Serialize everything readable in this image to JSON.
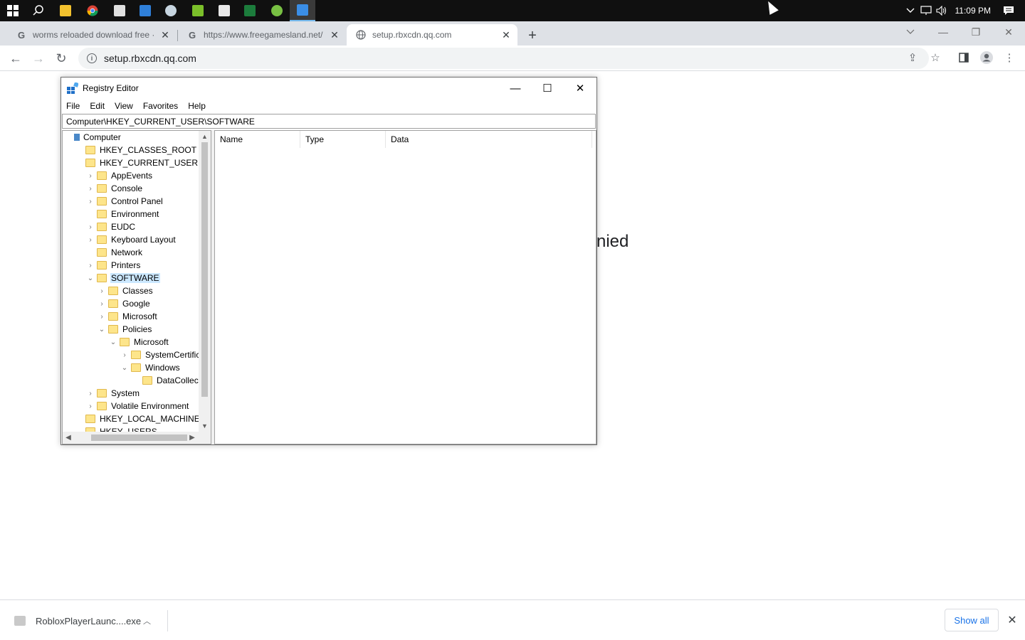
{
  "taskbar": {
    "icons": [
      {
        "name": "windows-start",
        "color": "#ffffff"
      },
      {
        "name": "search",
        "color": "#ffffff"
      },
      {
        "name": "file-explorer",
        "color": "#f2c12e"
      },
      {
        "name": "chrome",
        "color": "#4285f4"
      },
      {
        "name": "notes",
        "color": "#e0e0e0"
      },
      {
        "name": "app-blue",
        "color": "#2f7fd8"
      },
      {
        "name": "steam",
        "color": "#c7d5e0"
      },
      {
        "name": "bluestacks",
        "color": "#7bbf2a"
      },
      {
        "name": "7zip",
        "color": "#e8e8e8"
      },
      {
        "name": "app-green",
        "color": "#1c7c3c"
      },
      {
        "name": "utorrent",
        "color": "#78c043"
      },
      {
        "name": "regedit",
        "color": "#3a8ee6"
      }
    ],
    "clock": "11:09 PM"
  },
  "browser": {
    "tabs": [
      {
        "title": "worms reloaded download free ·",
        "favicon": "G",
        "active": false
      },
      {
        "title": "https://www.freegamesland.net/",
        "favicon": "G",
        "active": false
      },
      {
        "title": "setup.rbxcdn.qq.com",
        "favicon": "globe",
        "active": true
      }
    ],
    "address": "setup.rbxcdn.qq.com",
    "page_text_fragment": "nied"
  },
  "regedit": {
    "title": "Registry Editor",
    "menu": [
      "File",
      "Edit",
      "View",
      "Favorites",
      "Help"
    ],
    "address": "Computer\\HKEY_CURRENT_USER\\SOFTWARE",
    "tree": [
      {
        "label": "Computer",
        "depth": 0,
        "expander": "",
        "icon": "computer",
        "selected": false
      },
      {
        "label": "HKEY_CLASSES_ROOT",
        "depth": 1,
        "expander": "",
        "icon": "folder",
        "selected": false
      },
      {
        "label": "HKEY_CURRENT_USER",
        "depth": 1,
        "expander": "",
        "icon": "folder",
        "selected": false
      },
      {
        "label": "AppEvents",
        "depth": 2,
        "expander": ">",
        "icon": "folder",
        "selected": false
      },
      {
        "label": "Console",
        "depth": 2,
        "expander": ">",
        "icon": "folder",
        "selected": false
      },
      {
        "label": "Control Panel",
        "depth": 2,
        "expander": ">",
        "icon": "folder",
        "selected": false
      },
      {
        "label": "Environment",
        "depth": 2,
        "expander": "",
        "icon": "folder",
        "selected": false
      },
      {
        "label": "EUDC",
        "depth": 2,
        "expander": ">",
        "icon": "folder",
        "selected": false
      },
      {
        "label": "Keyboard Layout",
        "depth": 2,
        "expander": ">",
        "icon": "folder",
        "selected": false
      },
      {
        "label": "Network",
        "depth": 2,
        "expander": "",
        "icon": "folder",
        "selected": false
      },
      {
        "label": "Printers",
        "depth": 2,
        "expander": ">",
        "icon": "folder",
        "selected": false
      },
      {
        "label": "SOFTWARE",
        "depth": 2,
        "expander": "v",
        "icon": "folder",
        "selected": true
      },
      {
        "label": "Classes",
        "depth": 3,
        "expander": ">",
        "icon": "folder",
        "selected": false
      },
      {
        "label": "Google",
        "depth": 3,
        "expander": ">",
        "icon": "folder",
        "selected": false
      },
      {
        "label": "Microsoft",
        "depth": 3,
        "expander": ">",
        "icon": "folder",
        "selected": false
      },
      {
        "label": "Policies",
        "depth": 3,
        "expander": "v",
        "icon": "folder",
        "selected": false
      },
      {
        "label": "Microsoft",
        "depth": 4,
        "expander": "v",
        "icon": "folder",
        "selected": false
      },
      {
        "label": "SystemCertificates",
        "depth": 5,
        "expander": ">",
        "icon": "folder",
        "selected": false
      },
      {
        "label": "Windows",
        "depth": 5,
        "expander": "v",
        "icon": "folder",
        "selected": false
      },
      {
        "label": "DataCollection",
        "depth": 6,
        "expander": "",
        "icon": "folder",
        "selected": false
      },
      {
        "label": "System",
        "depth": 2,
        "expander": ">",
        "icon": "folder",
        "selected": false
      },
      {
        "label": "Volatile Environment",
        "depth": 2,
        "expander": ">",
        "icon": "folder",
        "selected": false
      },
      {
        "label": "HKEY_LOCAL_MACHINE",
        "depth": 1,
        "expander": "",
        "icon": "folder",
        "selected": false
      },
      {
        "label": "HKEY_USERS",
        "depth": 1,
        "expander": "",
        "icon": "folder",
        "selected": false
      }
    ],
    "columns": [
      "Name",
      "Type",
      "Data"
    ]
  },
  "downloads": {
    "file": "RobloxPlayerLaunc....exe",
    "show_all": "Show all"
  },
  "colors": {
    "taskbar_bg": "#101010",
    "tabstrip_bg": "#dee1e6",
    "selection_bg": "#cce8ff",
    "folder": "#fde58b",
    "link_blue": "#1a73e8"
  }
}
